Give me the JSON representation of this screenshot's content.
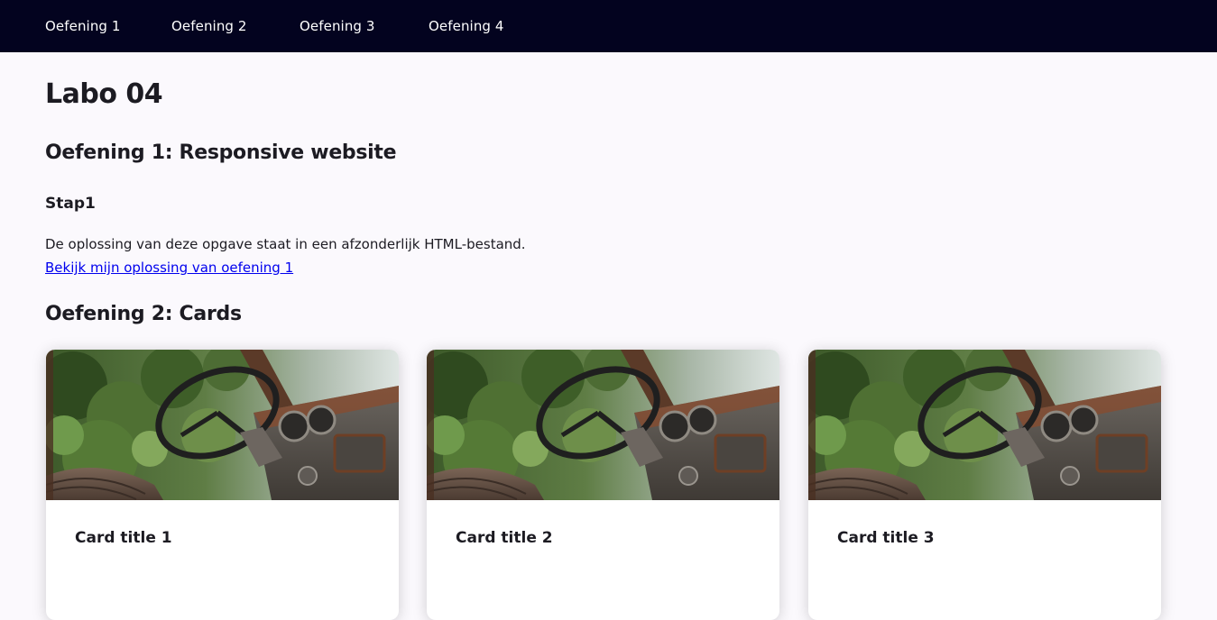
{
  "nav": {
    "links": [
      "Oefening 1",
      "Oefening 2",
      "Oefening 3",
      "Oefening 4"
    ]
  },
  "main": {
    "title": "Labo 04",
    "exercise1": {
      "heading": "Oefening 1: Responsive website",
      "step": "Stap1",
      "text": "De oplossing van deze opgave staat in een afzonderlijk HTML-bestand.",
      "link": "Bekijk mijn oplossing van oefening 1"
    },
    "exercise2": {
      "heading": "Oefening 2: Cards",
      "cards": [
        {
          "title": "Card title 1"
        },
        {
          "title": "Card title 2"
        },
        {
          "title": "Card title 3"
        }
      ]
    }
  },
  "colors": {
    "nav_background": "#03031f",
    "page_background": "#fbf9fd",
    "link": "#0000ee"
  }
}
